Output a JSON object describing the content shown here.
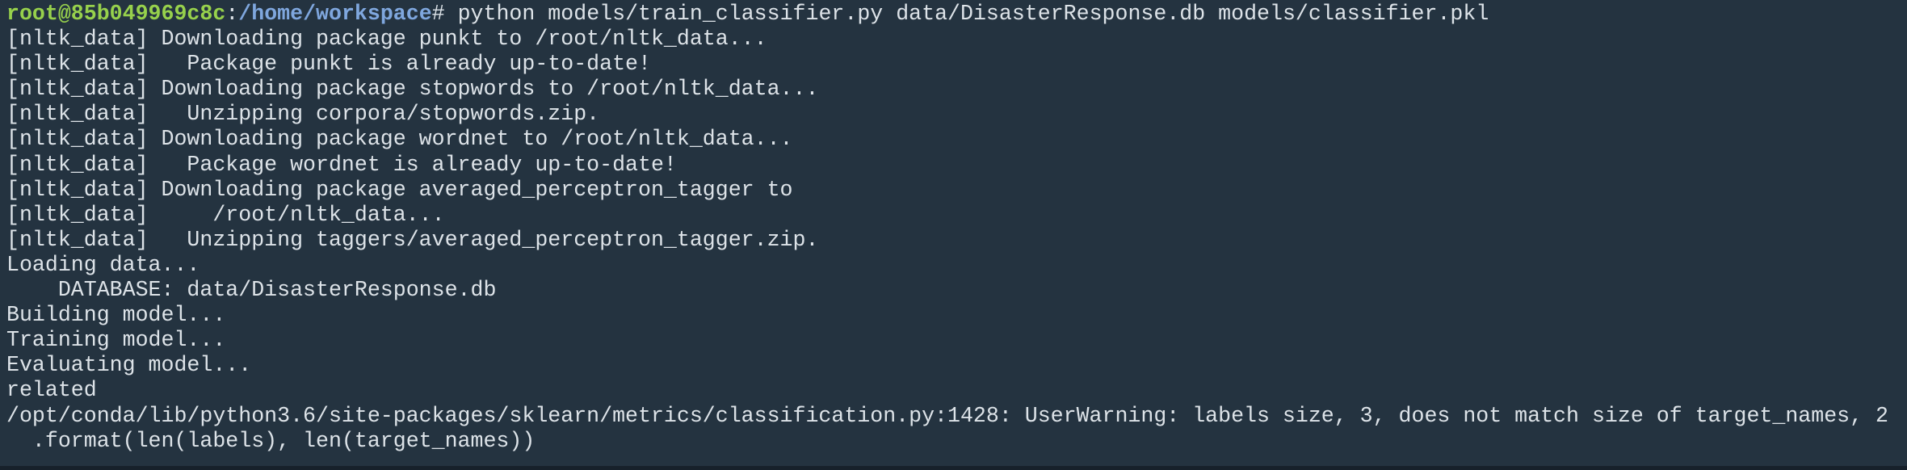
{
  "prompt": {
    "user_host": "root@85b049969c8c",
    "separator": ":",
    "path": "/home/workspace",
    "symbol": "#",
    "command": " python models/train_classifier.py data/DisasterResponse.db models/classifier.pkl"
  },
  "output_lines": [
    "[nltk_data] Downloading package punkt to /root/nltk_data...",
    "[nltk_data]   Package punkt is already up-to-date!",
    "[nltk_data] Downloading package stopwords to /root/nltk_data...",
    "[nltk_data]   Unzipping corpora/stopwords.zip.",
    "[nltk_data] Downloading package wordnet to /root/nltk_data...",
    "[nltk_data]   Package wordnet is already up-to-date!",
    "[nltk_data] Downloading package averaged_perceptron_tagger to",
    "[nltk_data]     /root/nltk_data...",
    "[nltk_data]   Unzipping taggers/averaged_perceptron_tagger.zip.",
    "Loading data...",
    "    DATABASE: data/DisasterResponse.db",
    "Building model...",
    "Training model...",
    "Evaluating model...",
    "related",
    "/opt/conda/lib/python3.6/site-packages/sklearn/metrics/classification.py:1428: UserWarning: labels size, 3, does not match size of target_names, 2",
    "  .format(len(labels), len(target_names))"
  ],
  "colors": {
    "background": "#243340",
    "text": "#dde3e8",
    "user_host": "#97d14c",
    "path": "#7fa7de"
  }
}
